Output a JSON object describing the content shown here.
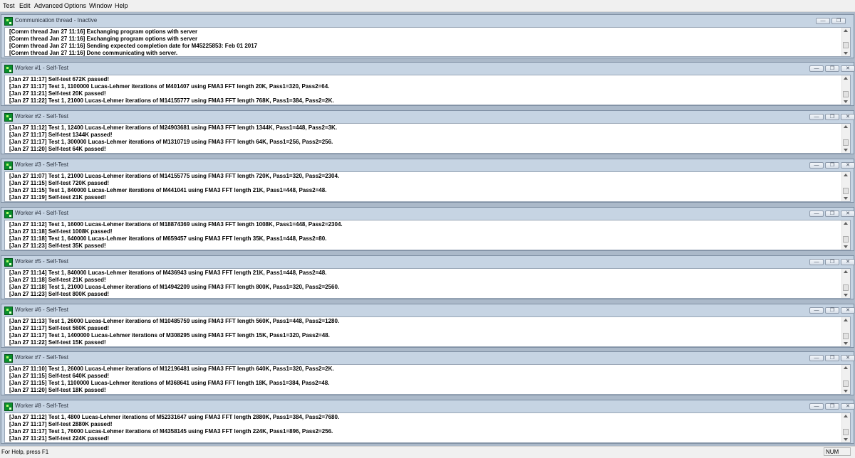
{
  "menu": [
    "Test",
    "Edit",
    "Advanced",
    "Options",
    "Window",
    "Help"
  ],
  "window_controls": {
    "minimize": "—",
    "restore": "❐",
    "close": "✕"
  },
  "windows": [
    {
      "title": "Communication thread - Inactive",
      "lines": [
        "[Comm thread Jan 27 11:16] Exchanging program options with server",
        "[Comm thread Jan 27 11:16] Exchanging program options with server",
        "[Comm thread Jan 27 11:16] Sending expected completion date for M45225853: Feb 01 2017",
        "[Comm thread Jan 27 11:16] Done communicating with server."
      ]
    },
    {
      "title": "Worker #1 - Self-Test",
      "lines": [
        "[Jan 27 11:17] Self-test 672K passed!",
        "[Jan 27 11:17] Test 1, 1100000 Lucas-Lehmer iterations of M401407 using FMA3 FFT length 20K, Pass1=320, Pass2=64.",
        "[Jan 27 11:21] Self-test 20K passed!",
        "[Jan 27 11:22] Test 1, 21000 Lucas-Lehmer iterations of M14155777 using FMA3 FFT length 768K, Pass1=384, Pass2=2K."
      ]
    },
    {
      "title": "Worker #2 - Self-Test",
      "lines": [
        "[Jan 27 11:12] Test 1, 12400 Lucas-Lehmer iterations of M24903681 using FMA3 FFT length 1344K, Pass1=448, Pass2=3K.",
        "[Jan 27 11:17] Self-test 1344K passed!",
        "[Jan 27 11:17] Test 1, 300000 Lucas-Lehmer iterations of M1310719 using FMA3 FFT length 64K, Pass1=256, Pass2=256.",
        "[Jan 27 11:20] Self-test 64K passed!"
      ]
    },
    {
      "title": "Worker #3 - Self-Test",
      "lines": [
        "[Jan 27 11:07] Test 1, 21000 Lucas-Lehmer iterations of M14155775 using FMA3 FFT length 720K, Pass1=320, Pass2=2304.",
        "[Jan 27 11:15] Self-test 720K passed!",
        "[Jan 27 11:15] Test 1, 840000 Lucas-Lehmer iterations of M441041 using FMA3 FFT length 21K, Pass1=448, Pass2=48.",
        "[Jan 27 11:19] Self-test 21K passed!"
      ]
    },
    {
      "title": "Worker #4 - Self-Test",
      "lines": [
        "[Jan 27 11:12] Test 1, 16000 Lucas-Lehmer iterations of M18874369 using FMA3 FFT length 1008K, Pass1=448, Pass2=2304.",
        "[Jan 27 11:18] Self-test 1008K passed!",
        "[Jan 27 11:18] Test 1, 640000 Lucas-Lehmer iterations of M659457 using FMA3 FFT length 35K, Pass1=448, Pass2=80.",
        "[Jan 27 11:23] Self-test 35K passed!"
      ]
    },
    {
      "title": "Worker #5 - Self-Test",
      "lines": [
        "[Jan 27 11:14] Test 1, 840000 Lucas-Lehmer iterations of M436943 using FMA3 FFT length 21K, Pass1=448, Pass2=48.",
        "[Jan 27 11:18] Self-test 21K passed!",
        "[Jan 27 11:18] Test 1, 21000 Lucas-Lehmer iterations of M14942209 using FMA3 FFT length 800K, Pass1=320, Pass2=2560.",
        "[Jan 27 11:23] Self-test 800K passed!"
      ]
    },
    {
      "title": "Worker #6 - Self-Test",
      "lines": [
        "[Jan 27 11:13] Test 1, 26000 Lucas-Lehmer iterations of M10485759 using FMA3 FFT length 560K, Pass1=448, Pass2=1280.",
        "[Jan 27 11:17] Self-test 560K passed!",
        "[Jan 27 11:17] Test 1, 1400000 Lucas-Lehmer iterations of M308295 using FMA3 FFT length 15K, Pass1=320, Pass2=48.",
        "[Jan 27 11:22] Self-test 15K passed!"
      ]
    },
    {
      "title": "Worker #7 - Self-Test",
      "lines": [
        "[Jan 27 11:10] Test 1, 26000 Lucas-Lehmer iterations of M12196481 using FMA3 FFT length 640K, Pass1=320, Pass2=2K.",
        "[Jan 27 11:15] Self-test 640K passed!",
        "[Jan 27 11:15] Test 1, 1100000 Lucas-Lehmer iterations of M368641 using FMA3 FFT length 18K, Pass1=384, Pass2=48.",
        "[Jan 27 11:20] Self-test 18K passed!"
      ]
    },
    {
      "title": "Worker #8 - Self-Test",
      "lines": [
        "[Jan 27 11:12] Test 1, 4800 Lucas-Lehmer iterations of M52331647 using FMA3 FFT length 2880K, Pass1=384, Pass2=7680.",
        "[Jan 27 11:17] Self-test 2880K passed!",
        "[Jan 27 11:17] Test 1, 76000 Lucas-Lehmer iterations of M4358145 using FMA3 FFT length 224K, Pass1=896, Pass2=256.",
        "[Jan 27 11:21] Self-test 224K passed!"
      ]
    }
  ],
  "status": {
    "help_text": "For Help, press F1",
    "num_indicator": "NUM"
  }
}
